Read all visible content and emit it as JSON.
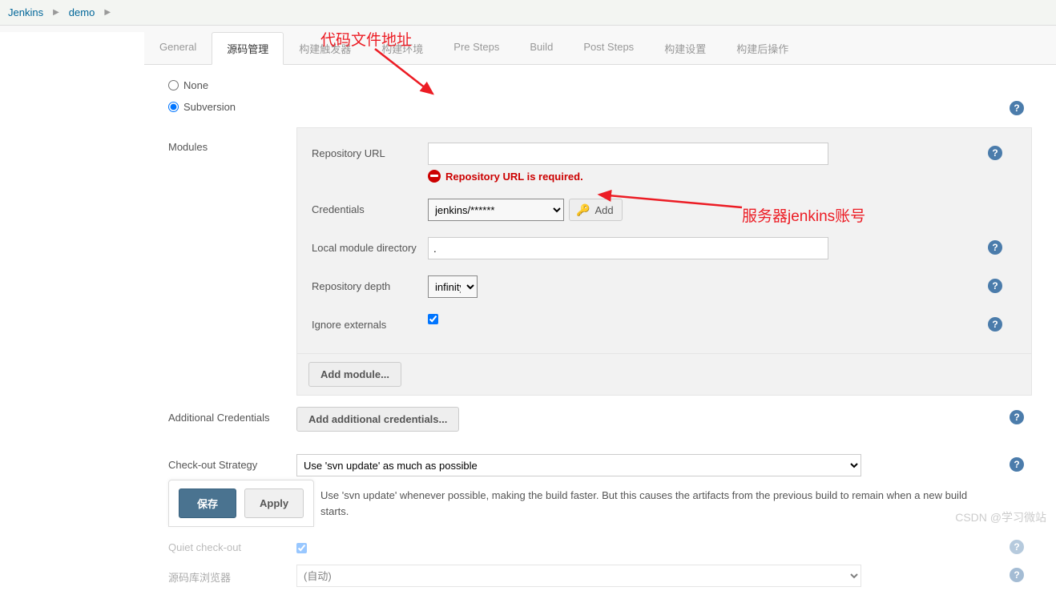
{
  "breadcrumb": {
    "item1": "Jenkins",
    "item2": "demo"
  },
  "tabs": {
    "general": "General",
    "scm": "源码管理",
    "triggers": "构建触发器",
    "env": "构建环境",
    "presteps": "Pre Steps",
    "build": "Build",
    "poststeps": "Post Steps",
    "settings": "构建设置",
    "postactions": "构建后操作"
  },
  "scm": {
    "none_label": "None",
    "svn_label": "Subversion",
    "modules_label": "Modules",
    "repo_url_label": "Repository URL",
    "repo_url_error": "Repository URL is required.",
    "credentials_label": "Credentials",
    "credentials_selected": "jenkins/******",
    "add_cred_label": "Add",
    "local_dir_label": "Local module directory",
    "local_dir_value": ".",
    "depth_label": "Repository depth",
    "depth_selected": "infinity",
    "ignore_externals_label": "Ignore externals",
    "add_module_label": "Add module...",
    "addl_cred_label": "Additional Credentials",
    "add_addl_cred_label": "Add additional credentials...",
    "checkout_strategy_label": "Check-out Strategy",
    "checkout_strategy_selected": "Use 'svn update' as much as possible",
    "checkout_strategy_desc": "Use 'svn update' whenever possible, making the build faster. But this causes the artifacts from the previous build to remain when a new build starts.",
    "quiet_checkout_label": "Quiet check-out",
    "repo_browser_label": "源码库浏览器",
    "repo_browser_selected": "(自动)"
  },
  "footer": {
    "save": "保存",
    "apply": "Apply"
  },
  "annotations": {
    "code_addr": "代码文件地址",
    "server_account": "服务器jenkins账号"
  },
  "watermark": "CSDN @学习微站"
}
